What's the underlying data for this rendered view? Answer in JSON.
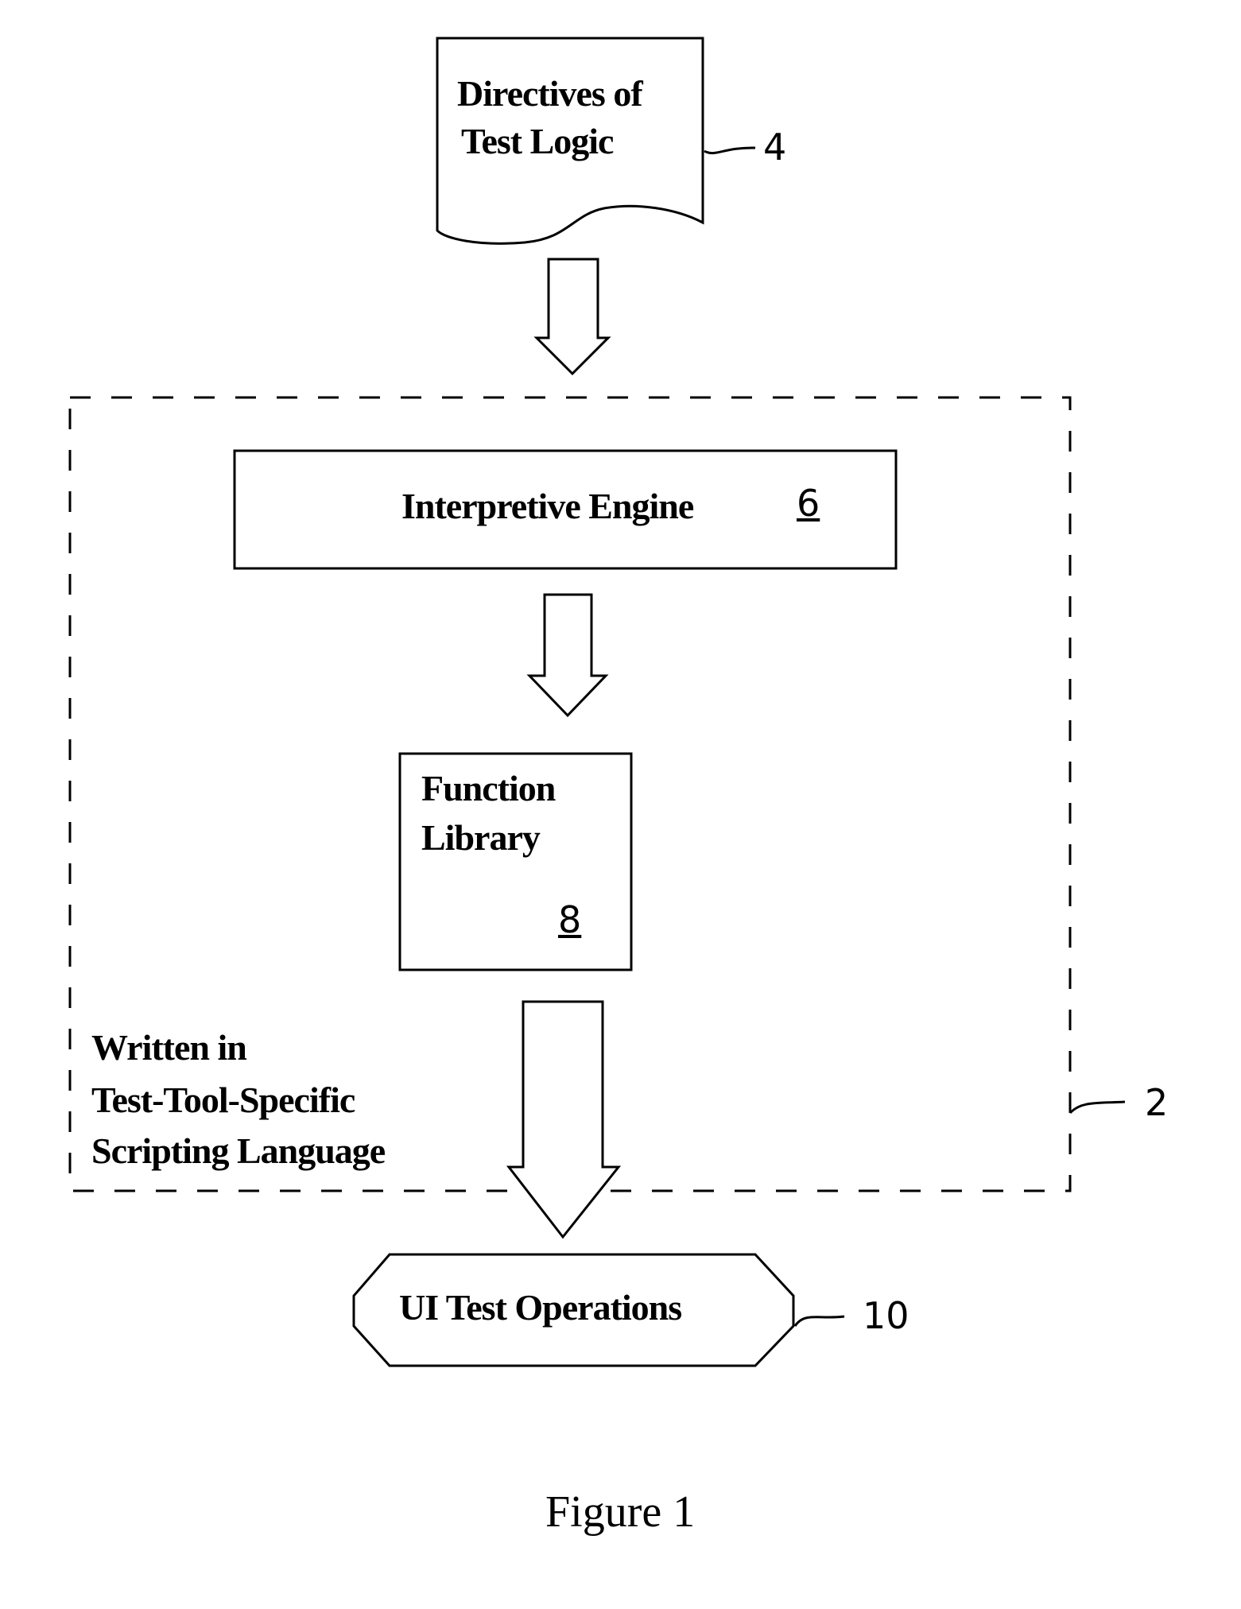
{
  "nodes": {
    "directives": {
      "line1": "Directives of",
      "line2": "Test Logic",
      "ref": "4"
    },
    "engine": {
      "label": "Interpretive Engine",
      "ref": "6"
    },
    "library": {
      "line1": "Function",
      "line2": "Library",
      "ref": "8"
    },
    "ui_ops": {
      "label": "UI Test Operations",
      "ref": "10"
    }
  },
  "container": {
    "line1": "Written in",
    "line2": "Test-Tool-Specific",
    "line3": "Scripting Language",
    "ref": "2"
  },
  "caption": "Figure 1"
}
